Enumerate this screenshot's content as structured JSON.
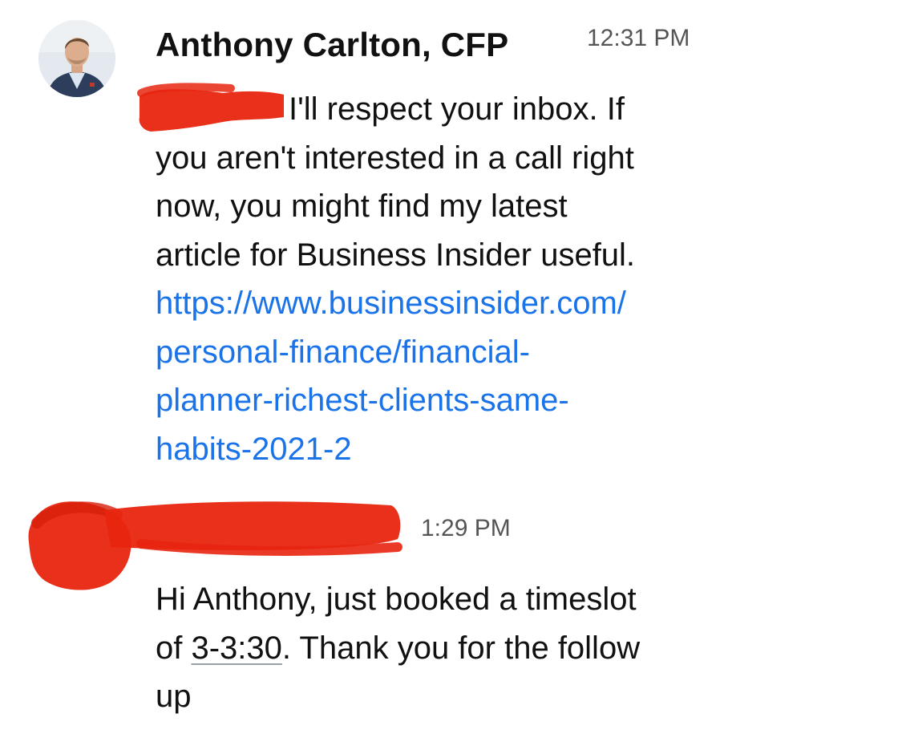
{
  "messages": [
    {
      "sender": "Anthony Carlton, CFP",
      "time": "12:31 PM",
      "lines": [
        "I'll respect your inbox. If",
        "you aren't interested in a call right",
        "now, you might find my latest",
        "article for Business Insider useful."
      ],
      "link_lines": [
        "https://www.businessinsider.com/",
        "personal-finance/financial-",
        "planner-richest-clients-same-",
        "habits-2021-2"
      ]
    },
    {
      "sender": "",
      "time": "1:29 PM",
      "line1": "Hi Anthony, just booked a timeslot",
      "line2_prefix": "of ",
      "line2_link": "3-3:30",
      "line2_suffix": ". Thank you for the follow",
      "line3": "up"
    }
  ],
  "colors": {
    "link": "#1a73e8",
    "redaction": "#e8250f",
    "timestamp": "#555555",
    "text": "#111111"
  },
  "icons": {
    "avatar": "profile-photo",
    "redaction": "red-scribble"
  }
}
